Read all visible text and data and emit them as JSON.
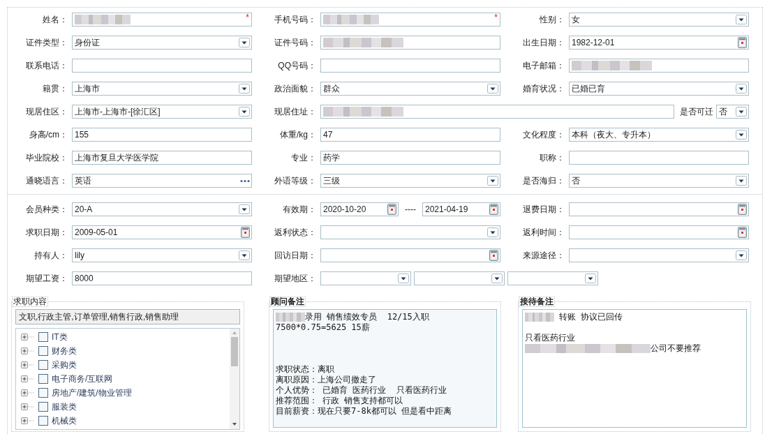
{
  "sections": [
    {
      "rows": [
        [
          {
            "label": "姓名：",
            "controls": [
              {
                "kind": "text",
                "redacted": true,
                "required_mark": "*"
              }
            ]
          },
          {
            "label": "手机号码：",
            "controls": [
              {
                "kind": "text",
                "redacted": true,
                "required_mark": "*"
              }
            ]
          },
          {
            "label": "性别：",
            "controls": [
              {
                "kind": "select",
                "value": "女"
              }
            ]
          }
        ],
        [
          {
            "label": "证件类型：",
            "controls": [
              {
                "kind": "select",
                "value": "身份证"
              }
            ]
          },
          {
            "label": "证件号码：",
            "controls": [
              {
                "kind": "text",
                "redacted": true
              }
            ]
          },
          {
            "label": "出生日期：",
            "controls": [
              {
                "kind": "date",
                "value": "1982-12-01"
              }
            ]
          }
        ],
        [
          {
            "label": "联系电话：",
            "controls": [
              {
                "kind": "text"
              }
            ]
          },
          {
            "label": "QQ号码：",
            "controls": [
              {
                "kind": "text"
              }
            ]
          },
          {
            "label": "电子邮箱：",
            "controls": [
              {
                "kind": "text",
                "redacted": true
              }
            ]
          }
        ],
        [
          {
            "label": "籍贯：",
            "controls": [
              {
                "kind": "select",
                "value": "上海市"
              }
            ]
          },
          {
            "label": "政治面貌：",
            "controls": [
              {
                "kind": "select",
                "value": "群众"
              }
            ]
          },
          {
            "label": "婚育状况：",
            "controls": [
              {
                "kind": "select",
                "value": "已婚已育"
              }
            ]
          }
        ],
        [
          {
            "label": "现居住区：",
            "controls": [
              {
                "kind": "select",
                "value": "上海市-上海市-[徐汇区]"
              }
            ]
          },
          {
            "label": "现居住址：",
            "controls": [
              {
                "kind": "text",
                "redacted": true
              },
              {
                "kind": "label",
                "text": "是否可迁"
              },
              {
                "kind": "select",
                "value": "否"
              }
            ]
          }
        ],
        [
          {
            "label": "身高/cm：",
            "controls": [
              {
                "kind": "text",
                "value": "155"
              }
            ]
          },
          {
            "label": "体重/kg：",
            "controls": [
              {
                "kind": "text",
                "value": "47"
              }
            ]
          },
          {
            "label": "文化程度：",
            "controls": [
              {
                "kind": "select",
                "value": "本科（夜大、专升本）"
              }
            ]
          }
        ],
        [
          {
            "label": "毕业院校：",
            "controls": [
              {
                "kind": "text",
                "value": "上海市复旦大学医学院"
              }
            ]
          },
          {
            "label": "专业：",
            "controls": [
              {
                "kind": "text",
                "value": "药学"
              }
            ]
          },
          {
            "label": "职称：",
            "controls": [
              {
                "kind": "text"
              }
            ]
          }
        ],
        [
          {
            "label": "通晓语言：",
            "controls": [
              {
                "kind": "lookup",
                "value": "英语"
              }
            ]
          },
          {
            "label": "外语等级：",
            "controls": [
              {
                "kind": "select",
                "value": "三级"
              }
            ]
          },
          {
            "label": "是否海归：",
            "controls": [
              {
                "kind": "select",
                "value": "否"
              }
            ]
          }
        ]
      ]
    },
    {
      "rows": [
        [
          {
            "label": "会员种类：",
            "controls": [
              {
                "kind": "select",
                "value": "20-A"
              }
            ]
          },
          {
            "label": "有效期：",
            "controls": [
              {
                "kind": "date",
                "value": "2020-10-20"
              },
              {
                "kind": "dash",
                "text": "----"
              },
              {
                "kind": "date",
                "value": "2021-04-19"
              }
            ]
          },
          {
            "label": "退费日期：",
            "controls": [
              {
                "kind": "date"
              }
            ]
          }
        ],
        [
          {
            "label": "求职日期：",
            "controls": [
              {
                "kind": "date",
                "value": "2009-05-01"
              }
            ]
          },
          {
            "label": "返利状态：",
            "controls": [
              {
                "kind": "select"
              }
            ]
          },
          {
            "label": "返利时间：",
            "controls": [
              {
                "kind": "date"
              }
            ]
          }
        ],
        [
          {
            "label": "持有人：",
            "controls": [
              {
                "kind": "select",
                "value": "lily"
              }
            ]
          },
          {
            "label": "回访日期：",
            "controls": [
              {
                "kind": "date"
              }
            ]
          },
          {
            "label": "来源途径：",
            "controls": [
              {
                "kind": "select"
              }
            ]
          }
        ],
        [
          {
            "label": "期望工资：",
            "controls": [
              {
                "kind": "text",
                "value": "8000"
              }
            ]
          },
          {
            "label": "期望地区：",
            "controls": [
              {
                "kind": "select"
              },
              {
                "kind": "select"
              },
              {
                "kind": "select"
              }
            ]
          }
        ]
      ]
    }
  ],
  "job_content": {
    "title": "求职内容",
    "summary": "文职,行政主管,订单管理,销售行政,销售助理",
    "categories": [
      {
        "label": "IT类",
        "expanded": false,
        "checked": false
      },
      {
        "label": "财务类",
        "expanded": false,
        "checked": false
      },
      {
        "label": "采购类",
        "expanded": false,
        "checked": false
      },
      {
        "label": "电子商务/互联网",
        "expanded": false,
        "checked": false
      },
      {
        "label": "房地产/建筑/物业管理",
        "expanded": false,
        "checked": false
      },
      {
        "label": "服装类",
        "expanded": false,
        "checked": false
      },
      {
        "label": "机械类",
        "expanded": false,
        "checked": false
      }
    ]
  },
  "advisor_notes": {
    "title": "顾问备注",
    "lines": [
      {
        "kind": "redacted_text",
        "text": "录用 销售绩效专员  12/15入职"
      },
      {
        "kind": "text",
        "text": "7500*0.75=5625 15薪"
      },
      {
        "kind": "blank"
      },
      {
        "kind": "blank"
      },
      {
        "kind": "blank"
      },
      {
        "kind": "text",
        "text": "求职状态：离职"
      },
      {
        "kind": "text",
        "text": "离职原因：上海公司撤走了"
      },
      {
        "kind": "text",
        "text": "个人优势： 已婚育 医药行业  只看医药行业"
      },
      {
        "kind": "text",
        "text": "推荐范围： 行政 销售支持都可以"
      },
      {
        "kind": "text",
        "text": "目前薪资：现在只要7-8k都可以 但是看中距离"
      }
    ]
  },
  "reception_notes": {
    "title": "接待备注",
    "lines": [
      {
        "kind": "redacted_text",
        "text": " 转账 协议已回传"
      },
      {
        "kind": "blank"
      },
      {
        "kind": "text",
        "text": "只看医药行业"
      },
      {
        "kind": "redacted_text",
        "text": "公司不要推荐"
      }
    ]
  }
}
